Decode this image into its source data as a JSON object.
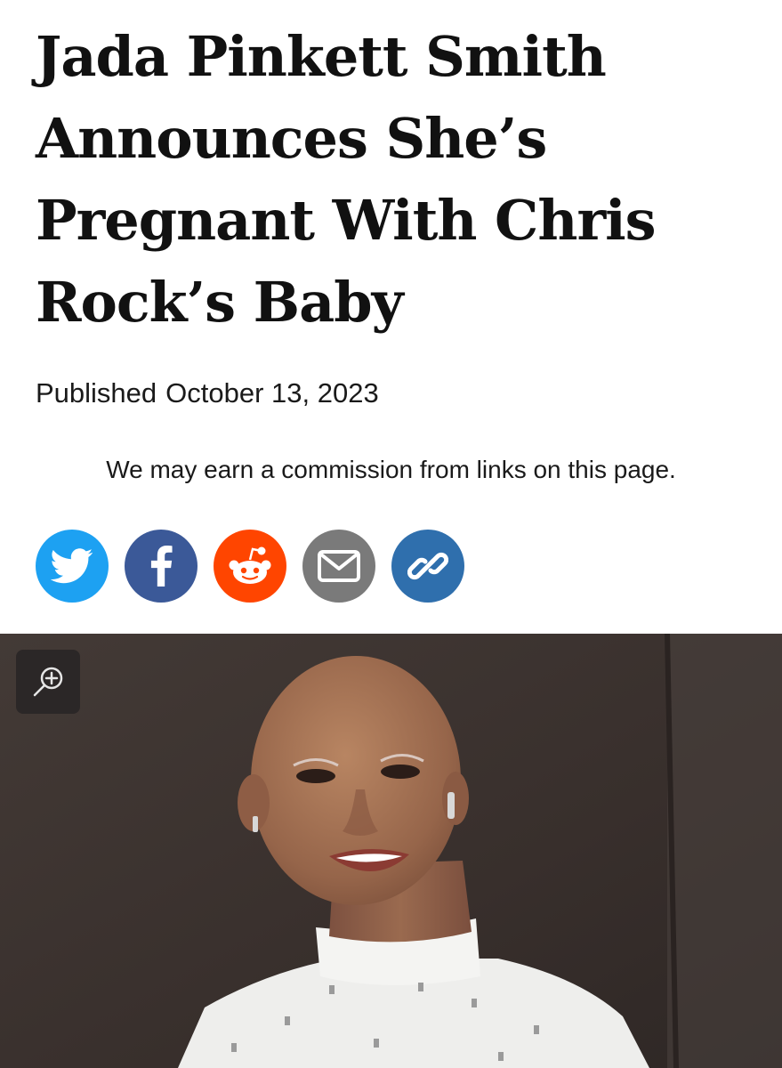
{
  "article": {
    "headline": "Jada Pinkett Smith Announces She’s Pregnant With Chris Rock’s Baby",
    "published_label": "Published",
    "published_date": "October 13, 2023",
    "disclaimer": "We may earn a commission from links on this page."
  },
  "share": [
    {
      "name": "twitter",
      "icon": "twitter-bird-icon",
      "color": "#1da1f2"
    },
    {
      "name": "facebook",
      "icon": "facebook-f-icon",
      "color": "#3b5998"
    },
    {
      "name": "reddit",
      "icon": "reddit-alien-icon",
      "color": "#ff4500"
    },
    {
      "name": "email",
      "icon": "envelope-icon",
      "color": "#7a7a7a"
    },
    {
      "name": "copy-link",
      "icon": "chain-link-icon",
      "color": "#2f6fad"
    }
  ],
  "hero": {
    "zoom_icon": "magnifier-plus-icon",
    "background": "#3b3330"
  }
}
